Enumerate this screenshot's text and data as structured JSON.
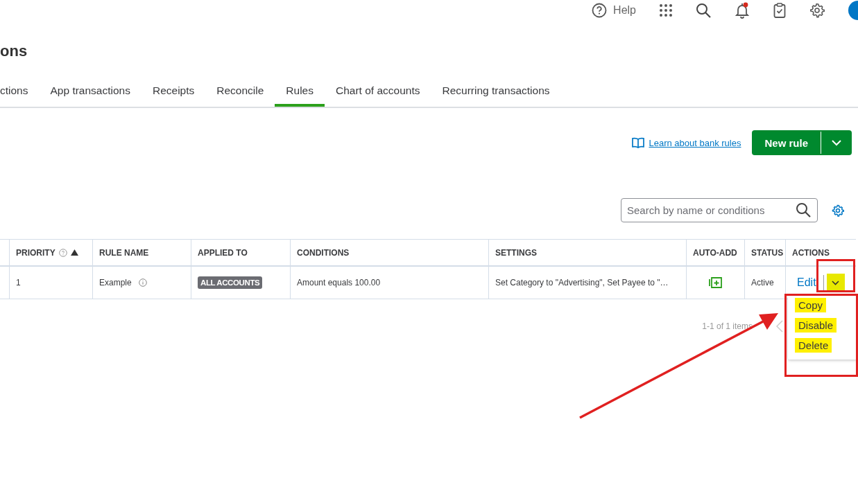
{
  "top_bar": {
    "help": "Help",
    "has_notification": true
  },
  "page_title": "ons",
  "tabs": [
    {
      "label": "ctions",
      "selected": false
    },
    {
      "label": "App transactions",
      "selected": false
    },
    {
      "label": "Receipts",
      "selected": false
    },
    {
      "label": "Reconcile",
      "selected": false
    },
    {
      "label": "Rules",
      "selected": true
    },
    {
      "label": "Chart of accounts",
      "selected": false
    },
    {
      "label": "Recurring transactions",
      "selected": false
    }
  ],
  "learn_link": "Learn about bank rules",
  "new_rule_button": "New rule",
  "search": {
    "placeholder": "Search by name or conditions"
  },
  "table": {
    "columns": [
      {
        "label": "PRIORITY",
        "help": true,
        "sorted": true
      },
      {
        "label": "RULE NAME",
        "help": false,
        "sorted": false
      },
      {
        "label": "APPLIED TO",
        "help": false,
        "sorted": false
      },
      {
        "label": "CONDITIONS",
        "help": false,
        "sorted": false
      },
      {
        "label": "SETTINGS",
        "help": false,
        "sorted": false
      },
      {
        "label": "AUTO-ADD",
        "help": false,
        "sorted": false
      },
      {
        "label": "STATUS",
        "help": false,
        "sorted": false
      },
      {
        "label": "ACTIONS",
        "help": false,
        "sorted": false
      }
    ],
    "rows": [
      {
        "priority": "1",
        "rule_name": "Example",
        "applied_to": "ALL ACCOUNTS",
        "conditions": "Amount equals 100.00",
        "settings": "Set Category to \"Advertising\", Set Payee to \"…",
        "auto_add": true,
        "status": "Active",
        "action": "Edit"
      }
    ]
  },
  "pagination": "1-1 of 1 items",
  "action_menu": {
    "expanded": true,
    "items": [
      {
        "label": "Copy",
        "highlighted": true
      },
      {
        "label": "Disable",
        "highlighted": true
      },
      {
        "label": "Delete",
        "highlighted": true
      }
    ]
  }
}
